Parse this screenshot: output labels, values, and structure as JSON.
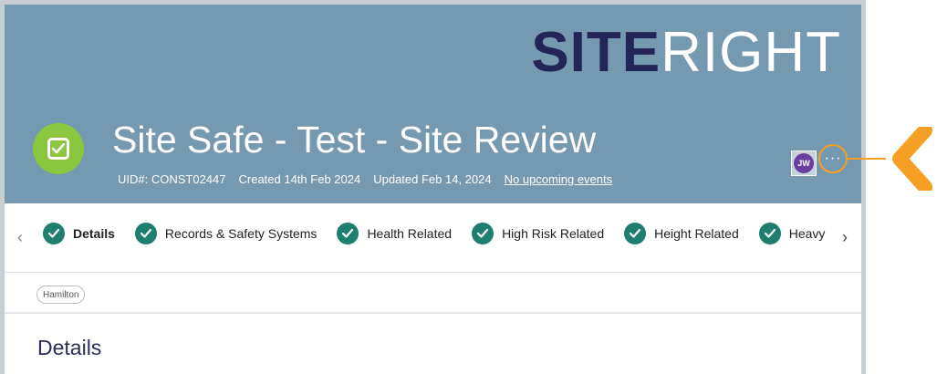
{
  "brand": {
    "logo_bold": "SITE",
    "logo_light": "RIGHT"
  },
  "record": {
    "title": "Site Safe - Test - Site Review",
    "uid": "UID#: CONST02447",
    "created": "Created 14th Feb 2024",
    "updated": "Updated Feb 14, 2024",
    "events_link": "No upcoming events",
    "icon": "checkbox-icon"
  },
  "actions": {
    "avatar_initials": "JW",
    "more_label": "···"
  },
  "tabs": [
    {
      "label": "Details",
      "active": true
    },
    {
      "label": "Records & Safety Systems",
      "active": false
    },
    {
      "label": "Health Related",
      "active": false
    },
    {
      "label": "High Risk Related",
      "active": false
    },
    {
      "label": "Height Related",
      "active": false
    },
    {
      "label": "Heavy",
      "active": false
    }
  ],
  "tags": [
    "Hamilton"
  ],
  "section": {
    "title": "Details"
  },
  "colors": {
    "header_bg": "#7499b1",
    "logo_dark": "#232458",
    "record_icon": "#8cc63f",
    "tab_check": "#1e7f6e",
    "callout": "#f5a024",
    "avatar": "#6a3fa0"
  }
}
